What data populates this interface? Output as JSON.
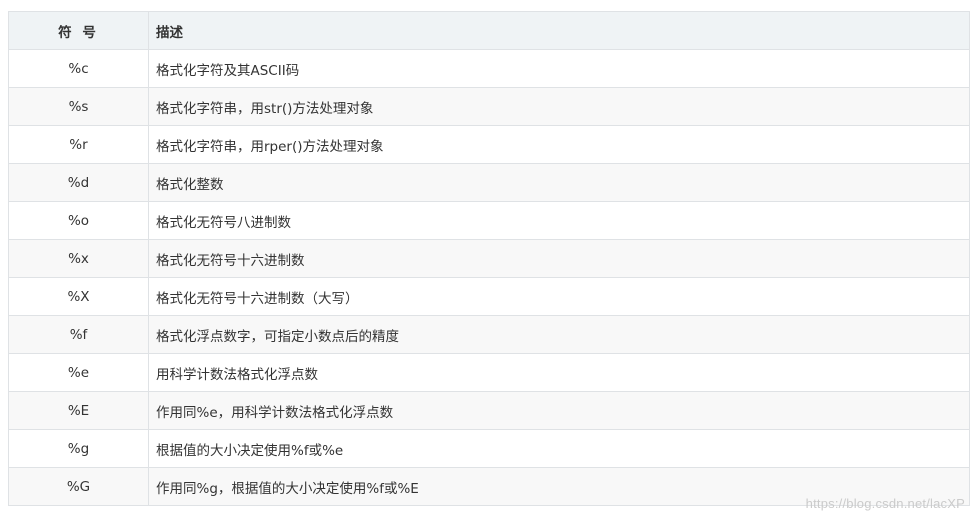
{
  "table": {
    "headers": [
      "符 号",
      "描述"
    ],
    "rows": [
      {
        "symbol": "%c",
        "description": "格式化字符及其ASCII码"
      },
      {
        "symbol": "%s",
        "description": "格式化字符串，用str()方法处理对象"
      },
      {
        "symbol": "%r",
        "description": "格式化字符串，用rper()方法处理对象"
      },
      {
        "symbol": "%d",
        "description": "格式化整数"
      },
      {
        "symbol": "%o",
        "description": "格式化无符号八进制数"
      },
      {
        "symbol": "%x",
        "description": "格式化无符号十六进制数"
      },
      {
        "symbol": "%X",
        "description": "格式化无符号十六进制数（大写）"
      },
      {
        "symbol": "%f",
        "description": "格式化浮点数字，可指定小数点后的精度"
      },
      {
        "symbol": "%e",
        "description": "用科学计数法格式化浮点数"
      },
      {
        "symbol": "%E",
        "description": "作用同%e，用科学计数法格式化浮点数"
      },
      {
        "symbol": "%g",
        "description": "根据值的大小决定使用%f或%e"
      },
      {
        "symbol": "%G",
        "description": "作用同%g，根据值的大小决定使用%f或%E"
      }
    ]
  },
  "watermark": "https://blog.csdn.net/lacXP"
}
